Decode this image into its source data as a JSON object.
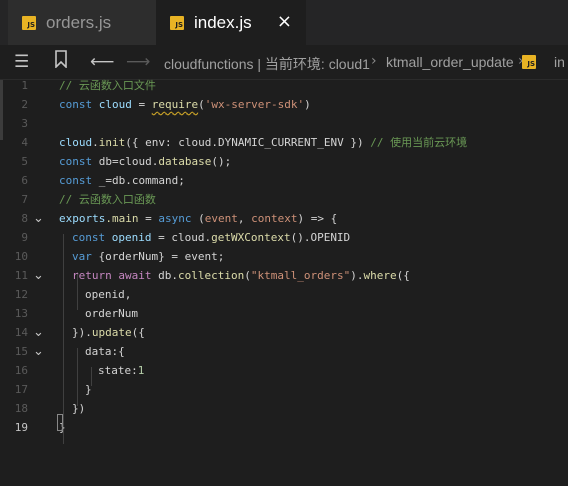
{
  "tabs": [
    {
      "label": "orders.js",
      "badge": "JS",
      "active": false
    },
    {
      "label": "index.js",
      "badge": "JS",
      "active": true
    }
  ],
  "tab_close_icon": "×",
  "breadcrumb": {
    "items": [
      "cloudfunctions | 当前环境: cloud1",
      "ktmall_order_update"
    ],
    "file_badge": "JS",
    "file_label": "in"
  },
  "editor": {
    "line_numbers": [
      "1",
      "2",
      "3",
      "4",
      "5",
      "6",
      "7",
      "8",
      "9",
      "10",
      "11",
      "12",
      "13",
      "14",
      "15",
      "16",
      "17",
      "18",
      "19"
    ],
    "current_line": 19,
    "fold_icon": "chevron-down-icon"
  },
  "colors": {
    "background": "#1e1e1e",
    "tabbar": "#252526",
    "js_badge": "#e8b324",
    "comment": "#6a9955",
    "keyword": "#569cd6",
    "string": "#ce9178",
    "function": "#dcdcaa",
    "variable": "#9cdcfe"
  },
  "code": {
    "l1": "// 云函数入口文件",
    "l2_const": "const",
    "l2_var": "cloud",
    "l2_eq": " = ",
    "l2_fn": "require",
    "l2_str": "'wx-server-sdk'",
    "l4_obj": "cloud",
    "l4_method": "init",
    "l4_mid": "({ env: cloud.DYNAMIC_CURRENT_ENV }) ",
    "l4_cmt": "// 使用当前云环境",
    "l5_const": "const",
    "l5_rest": " db=cloud.",
    "l5_fn": "database",
    "l5_end": "();",
    "l6_const": "const",
    "l6_rest": " _=db.command;",
    "l7": "// 云函数入口函数",
    "l8_exports": "exports",
    "l8_main": ".main",
    "l8_eq": " = ",
    "l8_async": "async",
    "l8_p1": "event",
    "l8_p2": "context",
    "l8_arrow": " => ",
    "l9_const": "const",
    "l9_var": " openid",
    "l9_eq": " = cloud.",
    "l9_fn": "getWXContext",
    "l9_end": "().OPENID",
    "l10_var": "var",
    "l10_rest": " {orderNum} = event;",
    "l11_return": "return",
    "l11_await": " await",
    "l11_db": " db.",
    "l11_fn": "collection",
    "l11_str": "\"ktmall_orders\"",
    "l11_where": "where",
    "l12": "openid,",
    "l13": "orderNum",
    "l14_a": "}).",
    "l14_fn": "update",
    "l14_b": "({",
    "l15": "data:{",
    "l16_key": "state:",
    "l16_num": "1",
    "l17": "}",
    "l18": "})",
    "l19": "}"
  }
}
